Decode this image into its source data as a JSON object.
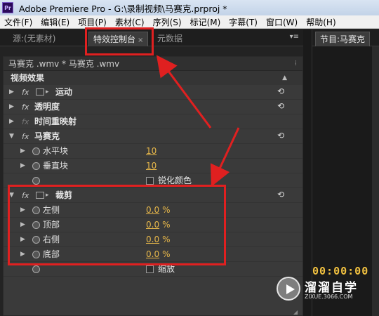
{
  "window": {
    "app_icon": "Pr",
    "title": "Adobe Premiere Pro - G:\\录制视频\\马赛克.prproj *"
  },
  "menu": [
    "文件(F)",
    "编辑(E)",
    "项目(P)",
    "素材(C)",
    "序列(S)",
    "标记(M)",
    "字幕(T)",
    "窗口(W)",
    "帮助(H)"
  ],
  "left_tabs": {
    "source": "源:(无素材)",
    "effect_controls": "特效控制台",
    "metadata": "元数据",
    "close_glyph": "×",
    "menu_glyph": "▾≡"
  },
  "right_panel": {
    "tab": "节目:马赛克",
    "timecode": "00:00:00"
  },
  "effect_controls": {
    "clip_header": "马赛克 .wmv * 马赛克 .wmv",
    "section_title": "视频效果",
    "rows": [
      {
        "kind": "effect",
        "label": "运动",
        "has_motion_icon": true
      },
      {
        "kind": "effect",
        "label": "透明度"
      },
      {
        "kind": "effect",
        "label": "时间重映射",
        "dim_fx": true
      },
      {
        "kind": "effect",
        "label": "马赛克",
        "expanded": true
      },
      {
        "kind": "param",
        "label": "水平块",
        "value": "10"
      },
      {
        "kind": "param",
        "label": "垂直块",
        "value": "10"
      },
      {
        "kind": "checkbox",
        "label": "锐化颜色"
      },
      {
        "kind": "effect",
        "label": "裁剪",
        "expanded": true,
        "has_motion_icon": true
      },
      {
        "kind": "param",
        "label": "左侧",
        "value": "0.0",
        "unit": "%"
      },
      {
        "kind": "param",
        "label": "顶部",
        "value": "0.0",
        "unit": "%"
      },
      {
        "kind": "param",
        "label": "右侧",
        "value": "0.0",
        "unit": "%"
      },
      {
        "kind": "param",
        "label": "底部",
        "value": "0.0",
        "unit": "%"
      },
      {
        "kind": "checkbox",
        "label": "缩放"
      }
    ]
  },
  "watermark": {
    "brand": "溜溜自学",
    "url": "ZIXUE.3066.COM"
  },
  "colors": {
    "annotation": "#e02020",
    "value_text": "#e8b84a",
    "timecode": "#f0c040"
  }
}
